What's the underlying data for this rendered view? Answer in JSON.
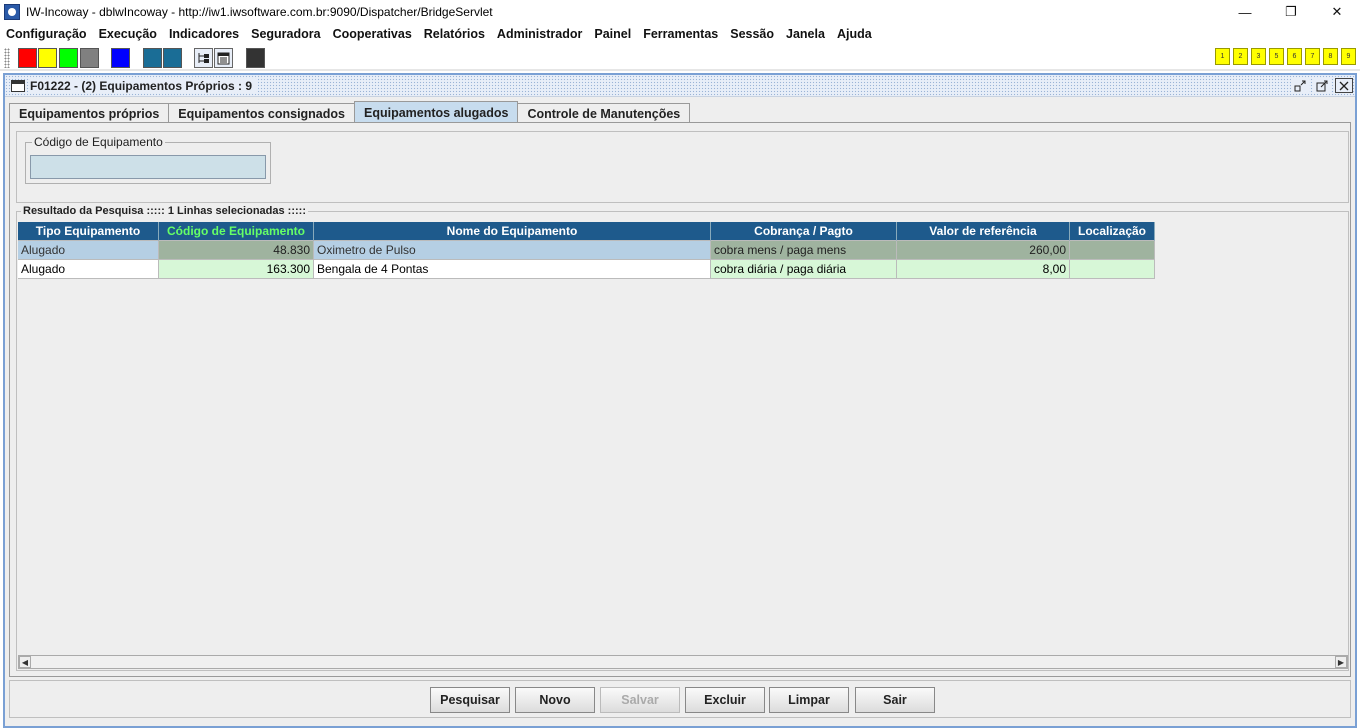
{
  "window": {
    "title": "IW-Incoway - dblwIncoway - http://iw1.iwsoftware.com.br:9090/Dispatcher/BridgeServlet",
    "minimize": "—",
    "restore": "❐",
    "close": "✕"
  },
  "menu": [
    "Configuração",
    "Execução",
    "Indicadores",
    "Seguradora",
    "Cooperativas",
    "Relatórios",
    "Administrador",
    "Painel",
    "Ferramentas",
    "Sessão",
    "Janela",
    "Ajuda"
  ],
  "toolbar": {
    "swatches": [
      "#ff0000",
      "#ffff00",
      "#00ff00",
      "#808080",
      "#0000ff",
      "#1a6d96",
      "#1a6d96",
      "#333333"
    ],
    "numbers": [
      "1",
      "2",
      "3",
      "5",
      "6",
      "7",
      "8",
      "9"
    ]
  },
  "frame": {
    "title": "F01222 - (2) Equipamentos Próprios : 9",
    "tabs": [
      "Equipamentos próprios",
      "Equipamentos consignados",
      "Equipamentos alugados",
      "Controle de Manutenções"
    ],
    "active_tab": 2
  },
  "search": {
    "legend": "Código de Equipamento",
    "value": ""
  },
  "result": {
    "legend": "Resultado da Pesquisa ::::: 1 Linhas selecionadas :::::",
    "columns": [
      "Tipo Equipamento",
      "Código de Equipamento",
      "Nome do Equipamento",
      "Cobrança / Pagto",
      "Valor de referência",
      "Localização"
    ],
    "rows": [
      [
        "Alugado",
        "48.830",
        "Oximetro de Pulso",
        "cobra mens / paga mens",
        "260,00",
        ""
      ],
      [
        "Alugado",
        "163.300",
        "Bengala de 4 Pontas",
        "cobra diária / paga diária",
        "8,00",
        ""
      ]
    ]
  },
  "buttons": {
    "search": "Pesquisar",
    "new": "Novo",
    "save": "Salvar",
    "delete": "Excluir",
    "clear": "Limpar",
    "exit": "Sair"
  }
}
